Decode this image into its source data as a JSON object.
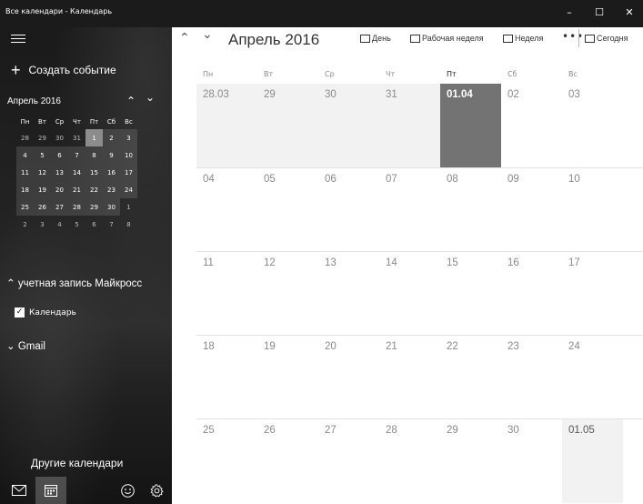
{
  "window": {
    "title": "Все календари - Календарь",
    "controls": [
      "–",
      "☐",
      "✕"
    ]
  },
  "sidebar": {
    "new_event_label": "Создать событие",
    "mini_calendar": {
      "month_label": "Апрель 2016",
      "weekdays": [
        "Пн",
        "Вт",
        "Ср",
        "Чт",
        "Пт",
        "Сб",
        "Вс"
      ],
      "weeks": [
        [
          "28",
          "29",
          "30",
          "31",
          "1",
          "2",
          "3"
        ],
        [
          "4",
          "5",
          "6",
          "7",
          "8",
          "9",
          "10"
        ],
        [
          "11",
          "12",
          "13",
          "14",
          "15",
          "16",
          "17"
        ],
        [
          "18",
          "19",
          "20",
          "21",
          "22",
          "23",
          "24"
        ],
        [
          "25",
          "26",
          "27",
          "28",
          "29",
          "30",
          "1"
        ],
        [
          "2",
          "3",
          "4",
          "5",
          "6",
          "7",
          "8"
        ]
      ],
      "today": "1"
    },
    "account_label": "учетная запись Майкросс",
    "calendar_checkbox_label": "Календарь",
    "gmail_label": "Gmail",
    "other_calendars_label": "Другие календари",
    "bottom_icons": [
      "mail-icon",
      "calendar-icon",
      "smiley-icon",
      "settings-icon"
    ]
  },
  "main": {
    "month_title": "Апрель 2016",
    "views": {
      "day": "День",
      "work_week": "Рабочая неделя",
      "week": "Неделя",
      "more": "•••",
      "today": "Сегодня"
    },
    "weekdays": [
      "Пн",
      "Вт",
      "Ср",
      "Чт",
      "Пт",
      "Сб",
      "Вс"
    ],
    "weeks": [
      [
        "28.03",
        "29",
        "30",
        "31",
        "01.04",
        "02",
        "03"
      ],
      [
        "04",
        "05",
        "06",
        "07",
        "08",
        "09",
        "10"
      ],
      [
        "11",
        "12",
        "13",
        "14",
        "15",
        "16",
        "17"
      ],
      [
        "18",
        "19",
        "20",
        "21",
        "22",
        "23",
        "24"
      ],
      [
        "25",
        "26",
        "27",
        "28",
        "29",
        "30",
        "01.05"
      ]
    ]
  },
  "colors": {
    "sidebar_bg": "#1e1e1e",
    "today_highlight": "#737373",
    "out_of_month_bg": "#f2f2f2"
  }
}
